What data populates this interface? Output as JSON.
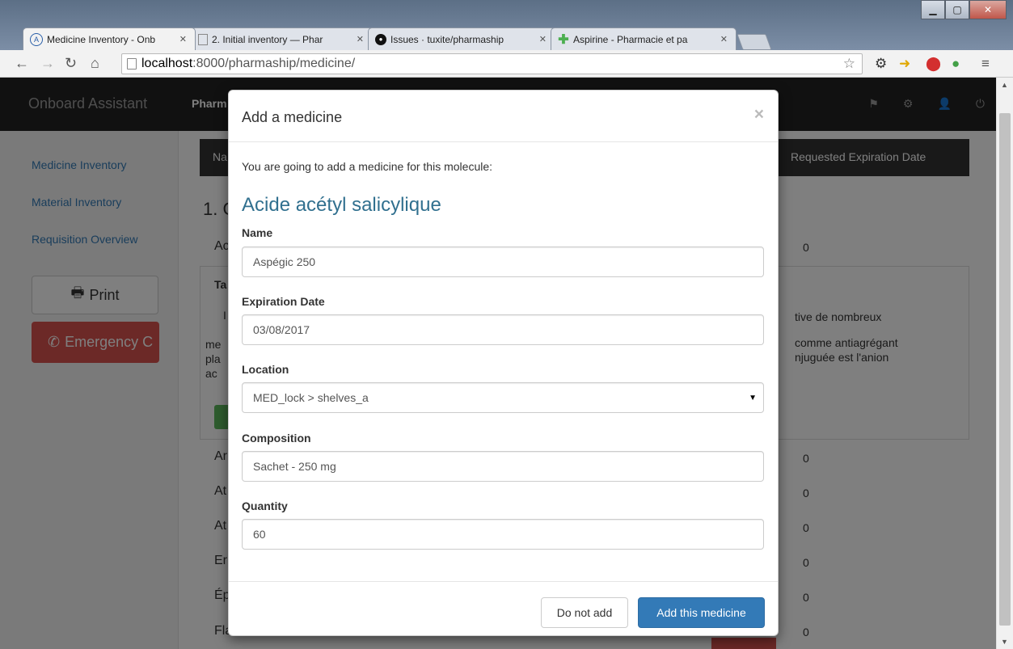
{
  "browser": {
    "tabs": [
      {
        "title": "Medicine Inventory - Onb",
        "icon": "app-logo-icon",
        "active": true
      },
      {
        "title": "2. Initial inventory — Phar",
        "icon": "page-icon",
        "active": false
      },
      {
        "title": "Issues · tuxite/pharmaship",
        "icon": "github-icon",
        "active": false
      },
      {
        "title": "Aspirine - Pharmacie et pa",
        "icon": "green-cross-icon",
        "active": false
      }
    ],
    "address": {
      "host": "localhost",
      "path": ":8000/pharmaship/medicine/"
    },
    "window_buttons": [
      "minimize",
      "maximize",
      "close"
    ]
  },
  "app": {
    "brand": "Onboard Assistant",
    "nav_item": "Pharm",
    "sidebar": {
      "links": [
        "Medicine Inventory",
        "Material Inventory",
        "Requisition Overview"
      ],
      "print_label": "Print",
      "emergency_label": "Emergency C"
    },
    "table": {
      "header_left": "Na",
      "header_right": "Requested  Expiration Date",
      "section_title": "1. C",
      "rows": [
        {
          "name": "Ac",
          "value": "0"
        },
        {
          "name": "Ar",
          "value": "0"
        },
        {
          "name": "At",
          "value": "0"
        },
        {
          "name": "At",
          "value": "0"
        },
        {
          "name": "Er",
          "value": "0"
        },
        {
          "name": "Ép",
          "value": "0"
        },
        {
          "name": "Flavonoïdes - Diosmine",
          "value": "0"
        }
      ],
      "detail": {
        "title_fragment": "Ta",
        "left_fragments": [
          "I",
          "me",
          "pla",
          "ac"
        ],
        "right_lines": [
          "tive de nombreux",
          "comme antiagrégant",
          "njuguée est l'anion"
        ]
      }
    }
  },
  "modal": {
    "title": "Add a medicine",
    "close_symbol": "×",
    "intro": "You are going to add a medicine for this molecule:",
    "molecule": "Acide acétyl salicylique",
    "fields": {
      "name": {
        "label": "Name",
        "value": "Aspégic 250"
      },
      "expiration": {
        "label": "Expiration Date",
        "value": "03/08/2017"
      },
      "location": {
        "label": "Location",
        "value": "MED_lock > shelves_a"
      },
      "composition": {
        "label": "Composition",
        "value": "Sachet - 250 mg"
      },
      "quantity": {
        "label": "Quantity",
        "value": "60"
      }
    },
    "cancel_label": "Do not add",
    "submit_label": "Add this medicine"
  },
  "colors": {
    "primary": "#337ab7",
    "danger": "#d9534f",
    "success": "#5cb85c",
    "navbar": "#222222",
    "molecule_text": "#31708f"
  }
}
